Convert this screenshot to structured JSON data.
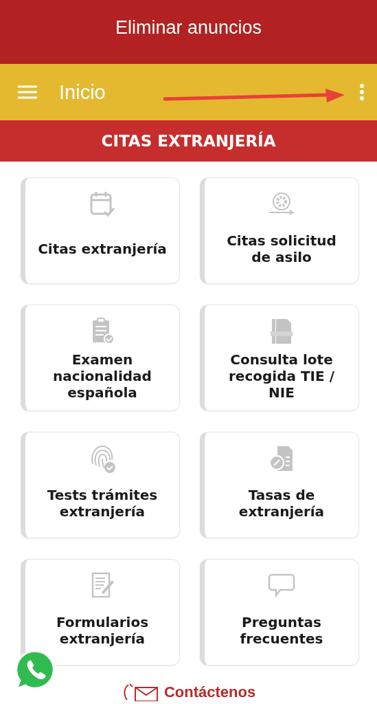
{
  "ad_bar": {
    "label": "Eliminar anuncios"
  },
  "app_bar": {
    "title": "Inicio"
  },
  "section_header": {
    "title": "CITAS EXTRANJERÍA"
  },
  "cards": [
    {
      "kind": "calendar",
      "label": "Citas extranjería"
    },
    {
      "kind": "cycle",
      "label": "Citas solicitud de asilo"
    },
    {
      "kind": "clipboard",
      "label": "Examen nacionalidad española"
    },
    {
      "kind": "document",
      "label": "Consulta lote recogida TIE / NIE"
    },
    {
      "kind": "fingerprint",
      "label": "Tests trámites extranjería"
    },
    {
      "kind": "tax",
      "label": "Tasas de extranjería"
    },
    {
      "kind": "form",
      "label": "Formularios extranjería"
    },
    {
      "kind": "chat",
      "label": "Preguntas frecuentes"
    }
  ],
  "contact": {
    "label": "Contáctenos"
  }
}
